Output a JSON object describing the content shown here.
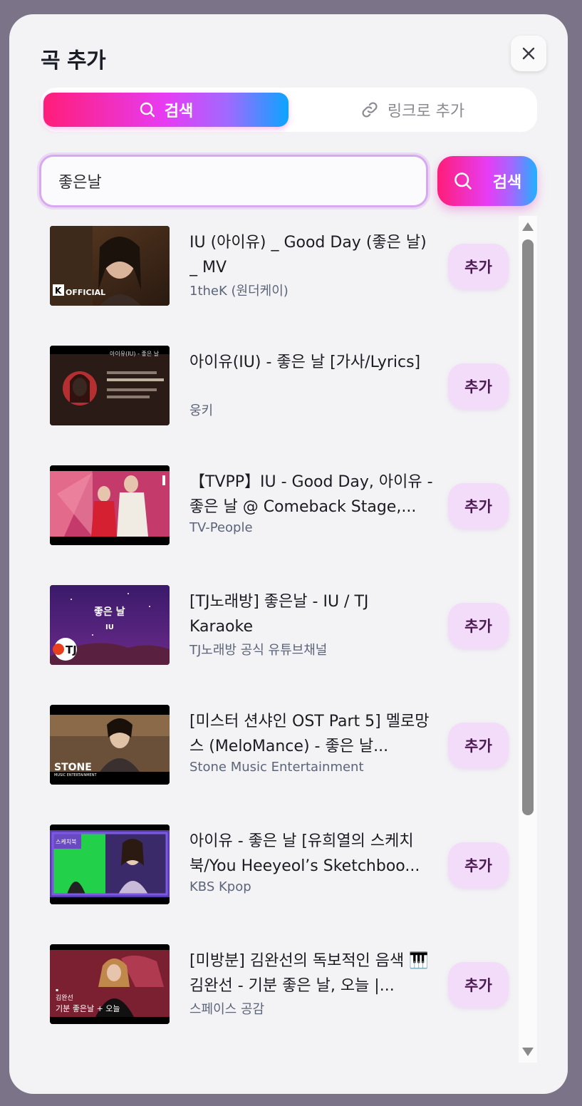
{
  "modal": {
    "title": "곡 추가",
    "close_icon": "close-icon"
  },
  "tabs": {
    "search_label": "검색",
    "link_label": "링크로 추가",
    "active": "search"
  },
  "search": {
    "value": "좋은날",
    "button_label": "검색"
  },
  "colors": {
    "gradient": [
      "#ff1d78",
      "#e73cf4",
      "#a169ff",
      "#0aa5ff"
    ],
    "add_button_bg": "#f3dcfa"
  },
  "results": [
    {
      "title": "IU (아이유) _ Good Day (좋은 날) _ MV",
      "channel": "1theK (원더케이)",
      "add_label": "추가"
    },
    {
      "title": "아이유(IU) - 좋은 날 [가사/Lyrics]",
      "channel": "웅키",
      "add_label": "추가"
    },
    {
      "title": "【TVPP】IU - Good Day, 아이유 - 좋은 날 @ Comeback Stage,...",
      "channel": "TV-People",
      "add_label": "추가"
    },
    {
      "title": "[TJ노래방] 좋은날 - IU / TJ Karaoke",
      "channel": "TJ노래방 공식 유튜브채널",
      "add_label": "추가"
    },
    {
      "title": "[미스터 션샤인 OST Part 5] 멜로망스 (MeloMance) - 좋은 날...",
      "channel": "Stone Music Entertainment",
      "add_label": "추가"
    },
    {
      "title": "아이유 - 좋은 날 [유희열의 스케치북/You Heeyeol’s Sketchboo...",
      "channel": "KBS Kpop",
      "add_label": "추가"
    },
    {
      "title": "[미방분] 김완선의 독보적인 음색 🎹 김완선 - 기분 좋은 날, 오늘 |...",
      "channel": "스페이스 공감",
      "add_label": "추가"
    }
  ],
  "thumbnails": [
    {
      "caption": "OFFICIAL",
      "badge": "K"
    },
    {
      "caption": "아이유(IU) - 좋은 날"
    },
    {
      "caption": ""
    },
    {
      "caption": "좋은 날",
      "sub": "IU",
      "badge": "TJ"
    },
    {
      "caption": "STONE",
      "sub": "MUSIC ENTERTAINMENT"
    },
    {
      "caption": "스케치북"
    },
    {
      "caption": "기분 좋은날 + 오늘",
      "sub": "김완선"
    }
  ]
}
